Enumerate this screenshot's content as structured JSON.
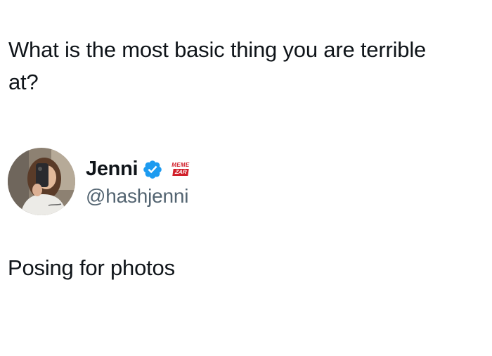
{
  "post": {
    "question": "What is the most basic thing you are terrible at?",
    "reply_text": "Posing for photos"
  },
  "author": {
    "display_name": "Jenni",
    "handle": "@hashjenni",
    "verified": true,
    "verified_icon": "verified-badge-icon",
    "verified_color": "#1d9bf0"
  },
  "watermark": {
    "line1": "MEME",
    "line2": "ZAR",
    "color": "#d11f2a"
  },
  "colors": {
    "text": "#0f1419",
    "secondary_text": "#536471",
    "background": "#ffffff"
  }
}
